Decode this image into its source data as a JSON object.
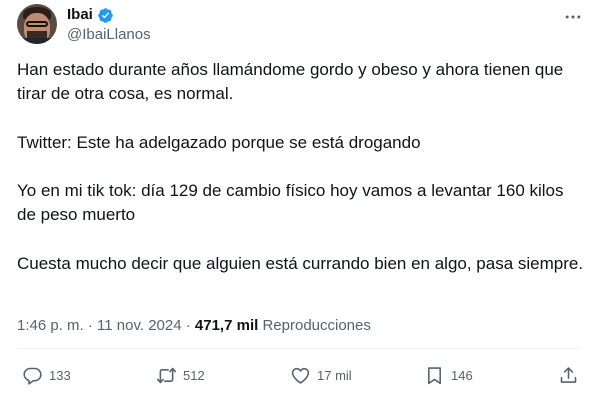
{
  "author": {
    "name": "Ibai",
    "handle": "@IbaiLlanos",
    "avatar_icon": "profile-photo",
    "verified_icon": "verified-badge-icon",
    "verified_color": "#1d9bf0"
  },
  "tweet": {
    "paragraphs": [
      "Han estado durante años llamándome gordo y obeso y ahora tienen que tirar de otra cosa, es normal.",
      "Twitter: Este ha adelgazado porque se está drogando",
      "Yo en mi tik tok: día 129 de cambio físico hoy vamos a levantar 160 kilos de peso muerto",
      "Cuesta mucho decir que alguien está currando bien en algo, pasa siempre."
    ],
    "time": "1:46 p. m.",
    "separator": "·",
    "date": "11 nov. 2024",
    "views_count": "471,7 mil",
    "views_label": "Reproducciones"
  },
  "actions": {
    "reply": {
      "icon": "reply-icon",
      "count": "133"
    },
    "retweet": {
      "icon": "retweet-icon",
      "count": "512"
    },
    "like": {
      "icon": "heart-icon",
      "count": "17 mil"
    },
    "bookmark": {
      "icon": "bookmark-icon",
      "count": "146"
    },
    "share": {
      "icon": "share-icon"
    }
  },
  "colors": {
    "text": "#0f1419",
    "secondary": "#536471",
    "accent": "#1d9bf0"
  }
}
